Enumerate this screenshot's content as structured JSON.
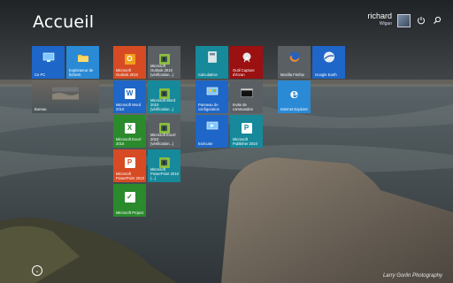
{
  "title": "Accueil",
  "user": {
    "name": "richard",
    "sub": "Wigan"
  },
  "credit": "Larry Gorlin Photography",
  "tiles": [
    {
      "label": "Ce PC",
      "icon": "computer-icon"
    },
    {
      "label": "Explorateur de fichiers",
      "icon": "folder-icon"
    },
    {
      "label": "Bureau",
      "icon": "desktop-icon"
    },
    {
      "label": "Microsoft Outlook 2010",
      "icon": "outlook-icon"
    },
    {
      "label": "Microsoft Outlook 2010 (vérification...)",
      "icon": "tool-icon"
    },
    {
      "label": "Microsoft Word 2010",
      "icon": "word-icon"
    },
    {
      "label": "Microsoft Word 2010 (vérification...)",
      "icon": "tool-icon"
    },
    {
      "label": "Microsoft Excel 2010",
      "icon": "excel-icon"
    },
    {
      "label": "Microsoft Excel 2010 (vérification...)",
      "icon": "tool-icon"
    },
    {
      "label": "Microsoft PowerPoint 2010",
      "icon": "powerpoint-icon"
    },
    {
      "label": "Microsoft PowerPoint 2010 (...)",
      "icon": "tool-icon"
    },
    {
      "label": "Microsoft Project",
      "icon": "project-icon"
    },
    {
      "label": "Calculatrice",
      "icon": "calculator-icon"
    },
    {
      "label": "Outil Capture d'écran",
      "icon": "scissors-icon"
    },
    {
      "label": "Panneau de configuration",
      "icon": "control-panel-icon"
    },
    {
      "label": "Invite de commandes",
      "icon": "cmd-icon"
    },
    {
      "label": "Exécuter",
      "icon": "run-icon"
    },
    {
      "label": "Microsoft Publisher 2010",
      "icon": "publisher-icon"
    },
    {
      "label": "Mozilla Firefox",
      "icon": "firefox-icon"
    },
    {
      "label": "Google Earth",
      "icon": "earth-icon"
    },
    {
      "label": "Internet Explorer",
      "icon": "ie-icon"
    }
  ],
  "colors": {
    "blue": "#1e66c7",
    "orange": "#d74b24",
    "green": "#2a8a2c",
    "teal": "#16899a",
    "gray": "#5a5f63",
    "darkred": "#9b1010",
    "lightblue": "#2a8ad6"
  }
}
